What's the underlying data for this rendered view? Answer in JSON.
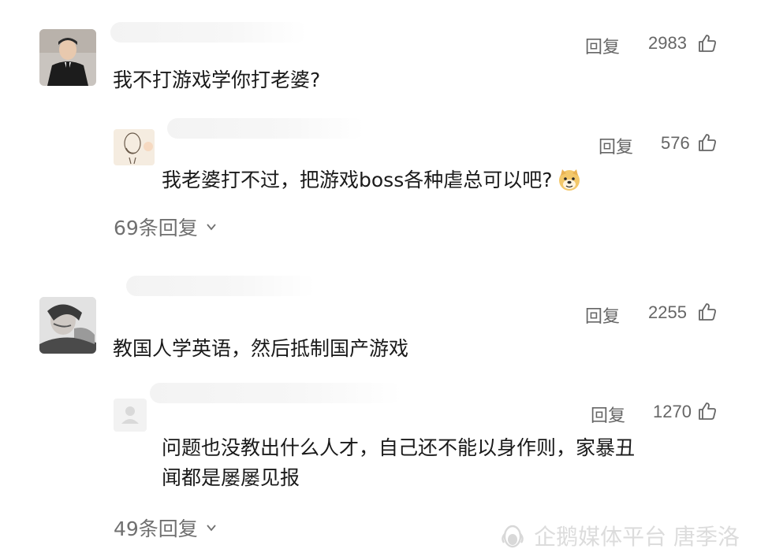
{
  "comments": [
    {
      "text": "我不打游戏学你打老婆?",
      "reply_label": "回复",
      "likes": "2983",
      "reply": {
        "text": "我老婆打不过，把游戏boss各种虐总可以吧?",
        "emoji": "doge-emoji",
        "reply_label": "回复",
        "likes": "576"
      },
      "more_replies": "69条回复"
    },
    {
      "text": "教国人学英语，然后抵制国产游戏",
      "reply_label": "回复",
      "likes": "2255",
      "reply": {
        "text_line1": "问题也没教出什么人才，自己还不能以身作则，家暴丑",
        "text_line2": "闻都是屡屡见报",
        "reply_label": "回复",
        "likes": "1270"
      },
      "more_replies": "49条回复"
    }
  ],
  "watermark": "企鹅媒体平台 唐季洛",
  "colors": {
    "text": "#1a1a1a",
    "secondary": "#666666",
    "watermark": "#dcdcdc"
  }
}
